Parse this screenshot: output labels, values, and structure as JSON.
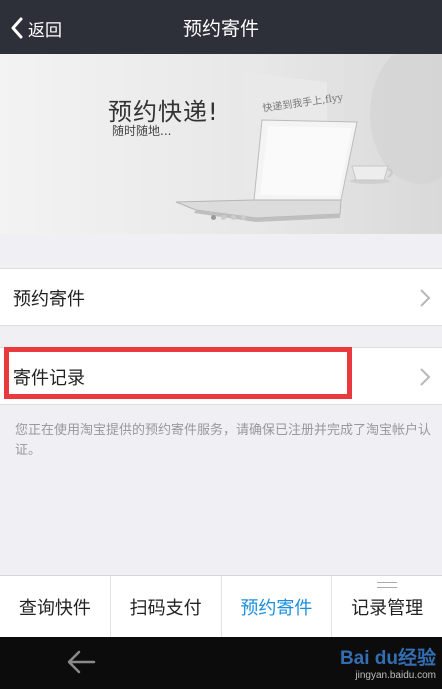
{
  "header": {
    "back_label": "返回",
    "title": "预约寄件"
  },
  "banner": {
    "headline": "预约快递!",
    "subline": "随时随地...",
    "script_text": "快递到我手上,flyy",
    "slides": 4,
    "active_slide": 1
  },
  "menu": {
    "items": [
      {
        "label": "预约寄件"
      },
      {
        "label": "寄件记录",
        "highlighted": true
      }
    ]
  },
  "notice": "您正在使用淘宝提供的预约寄件服务，请确保已注册并完成了淘宝帐户认证。",
  "tabs": [
    {
      "label": "查询快件",
      "active": false
    },
    {
      "label": "扫码支付",
      "active": false
    },
    {
      "label": "预约寄件",
      "active": true
    },
    {
      "label": "记录管理",
      "active": false
    }
  ],
  "watermark": {
    "brand": "Bai du经验",
    "url": "jingyan.baidu.com"
  },
  "colors": {
    "top_bar": "#2d3038",
    "active_tab": "#1d8fdc",
    "highlight": "#e83a3f",
    "background": "#efeff4"
  },
  "icons": {
    "back": "chevron-left-icon",
    "row_arrow": "chevron-right-icon",
    "system_back": "arrow-left-icon"
  }
}
